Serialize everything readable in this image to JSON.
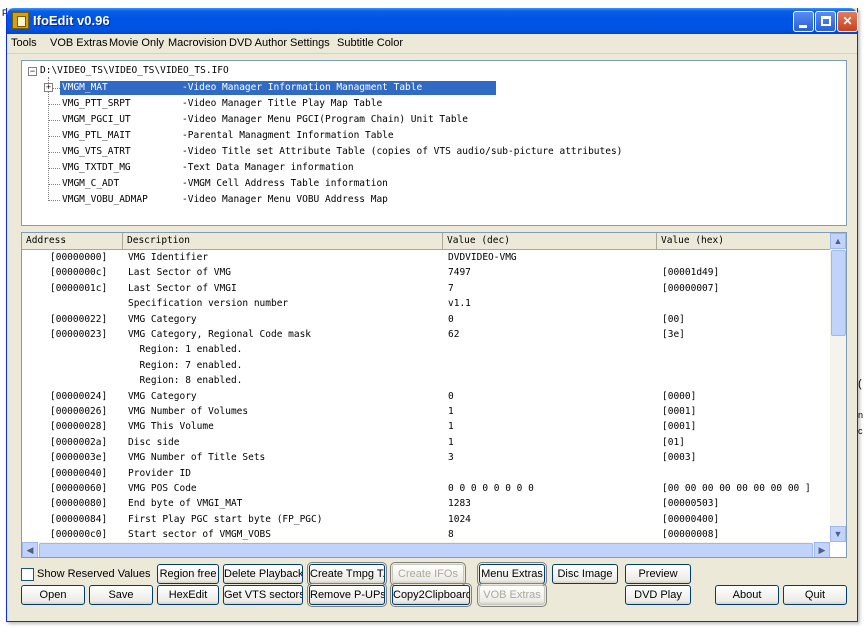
{
  "window": {
    "title": "IfoEdit v0.96"
  },
  "menu": [
    "Tools",
    "VOB Extras",
    "Movie Only",
    "Macrovision",
    "DVD Author",
    "Settings",
    "Subtitle Color"
  ],
  "tree": {
    "root": "D:\\VIDEO_TS\\VIDEO_TS\\VIDEO_TS.IFO",
    "items": [
      {
        "name": "VMGM_MAT",
        "desc": "-Video Manager Information Managment Table",
        "selected": true,
        "expandable": true
      },
      {
        "name": "VMG_PTT_SRPT",
        "desc": "-Video Manager Title Play Map Table"
      },
      {
        "name": "VMGM_PGCI_UT",
        "desc": "-Video Manager Menu PGCI(Program Chain) Unit Table"
      },
      {
        "name": "VMG_PTL_MAIT",
        "desc": "-Parental Managment Information Table"
      },
      {
        "name": "VMG_VTS_ATRT",
        "desc": "-Video Title set Attribute Table (copies of VTS audio/sub-picture attributes)"
      },
      {
        "name": "VMG_TXTDT_MG",
        "desc": "-Text Data Manager information"
      },
      {
        "name": "VMGM_C_ADT",
        "desc": "-VMGM Cell Address Table information"
      },
      {
        "name": "VMGM_VOBU_ADMAP",
        "desc": "-Video Manager Menu VOBU Address Map"
      }
    ]
  },
  "grid": {
    "columns": [
      "Address",
      "Description",
      "Value (dec)",
      "Value (hex)"
    ],
    "rows": [
      [
        "[00000000]",
        "VMG Identifier",
        "DVDVIDEO-VMG",
        ""
      ],
      [
        "[0000000c]",
        "Last Sector of VMG",
        "7497",
        "[00001d49]"
      ],
      [
        "[0000001c]",
        "Last Sector of VMGI",
        "7",
        "[00000007]"
      ],
      [
        "",
        "Specification version number",
        "v1.1",
        ""
      ],
      [
        "[00000022]",
        "VMG Category",
        "0",
        "[00]"
      ],
      [
        "[00000023]",
        "VMG Category, Regional Code mask",
        "62",
        "[3e]"
      ],
      [
        "",
        "  Region: 1 enabled.",
        "",
        ""
      ],
      [
        "",
        "  Region: 7 enabled.",
        "",
        ""
      ],
      [
        "",
        "  Region: 8 enabled.",
        "",
        ""
      ],
      [
        "[00000024]",
        "VMG Category",
        "0",
        "[0000]"
      ],
      [
        "[00000026]",
        "VMG Number of Volumes",
        "1",
        "[0001]"
      ],
      [
        "[00000028]",
        "VMG This Volume",
        "1",
        "[0001]"
      ],
      [
        "[0000002a]",
        "Disc side",
        "1",
        "[01]"
      ],
      [
        "[0000003e]",
        "VMG Number of Title Sets",
        "3",
        "[0003]"
      ],
      [
        "[00000040]",
        "Provider ID",
        "",
        ""
      ],
      [
        "[00000060]",
        "VMG POS Code",
        "0 0 0 0 0 0 0 0",
        "[00 00 00 00 00 00 00 00 ]"
      ],
      [
        "[00000080]",
        "End byte of VMGI_MAT",
        "1283",
        "[00000503]"
      ],
      [
        "[00000084]",
        "First Play PGC start byte (FP_PGC)",
        "1024",
        "[00000400]"
      ],
      [
        "[000000c0]",
        "Start sector of VMGM_VOBS",
        "8",
        "[00000008]"
      ]
    ]
  },
  "options": {
    "show_reserved_label": "Show Reserved Values",
    "show_reserved_checked": false
  },
  "buttons": {
    "region_free": "Region free",
    "delete_playback": "Delete Playback",
    "create_tmpg": "Create Tmpg T.",
    "create_ifos": "Create IFOs",
    "menu_extras": "Menu Extras",
    "disc_image": "Disc Image",
    "preview": "Preview",
    "open": "Open",
    "save": "Save",
    "hexedit": "HexEdit",
    "get_vts_sectors": "Get VTS sectors",
    "remove_pups": "Remove P-UPs",
    "copy2clipboard": "Copy2Clipboard",
    "vob_extras": "VOB Extras",
    "dvd_play": "DVD Play",
    "about": "About",
    "quit": "Quit"
  }
}
